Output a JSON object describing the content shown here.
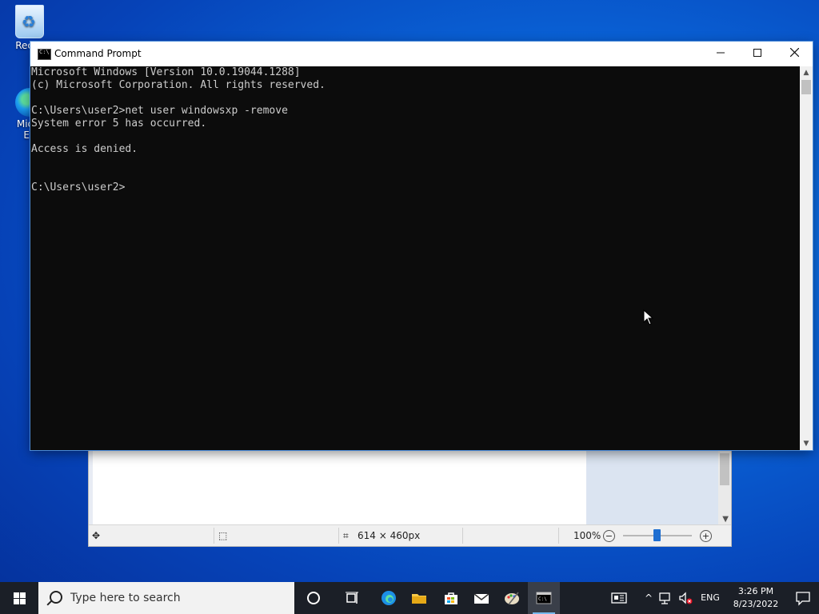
{
  "desktop": {
    "icons": [
      {
        "label": "Recyc"
      },
      {
        "label": "Micro\nEd"
      }
    ]
  },
  "paint_window": {
    "status": {
      "dimensions": "614 × 460px",
      "zoom": "100%"
    }
  },
  "cmd_window": {
    "title": "Command Prompt",
    "buttons": {
      "minimize": "—",
      "maximize": "☐",
      "close": "✕"
    },
    "lines": [
      "Microsoft Windows [Version 10.0.19044.1288]",
      "(c) Microsoft Corporation. All rights reserved.",
      "",
      "C:\\Users\\user2>net user windowsxp -remove",
      "System error 5 has occurred.",
      "",
      "Access is denied.",
      "",
      "",
      "C:\\Users\\user2>"
    ]
  },
  "taskbar": {
    "search_placeholder": "Type here to search",
    "language": "ENG",
    "time": "3:26 PM",
    "date": "8/23/2022",
    "icons": [
      "windows-start-icon",
      "cortana-icon",
      "task-view-icon",
      "edge-icon",
      "file-explorer-icon",
      "store-icon",
      "mail-icon",
      "paint-icon",
      "cmd-icon"
    ]
  }
}
